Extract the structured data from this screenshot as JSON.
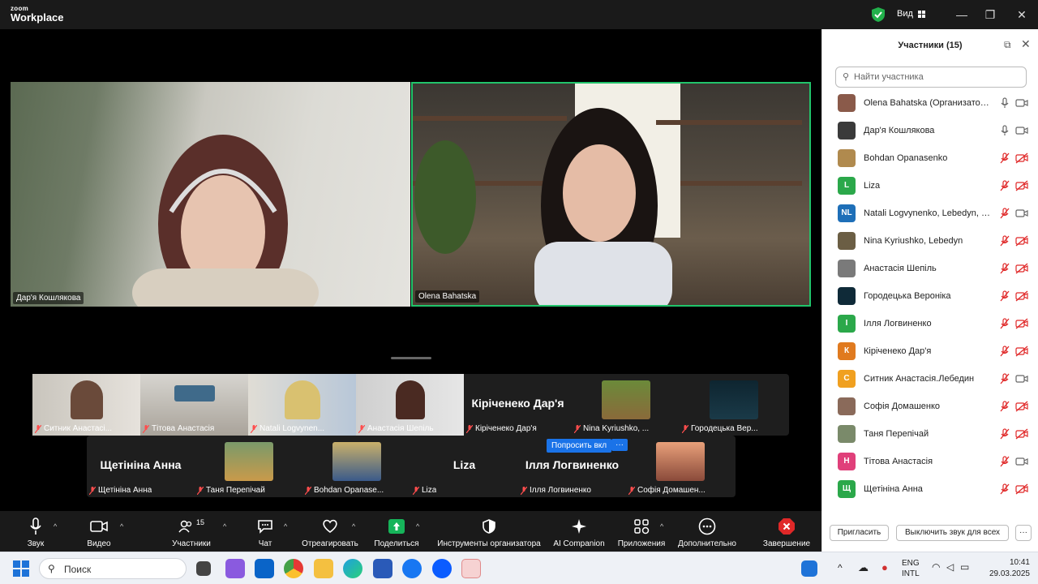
{
  "window": {
    "logo_top": "zoom",
    "logo_bottom": "Workplace",
    "view_label": "Вид",
    "minimize": "—",
    "maximize": "❐",
    "close": "✕"
  },
  "stage": {
    "main_videos": [
      {
        "name": "Дар'я Кошлякова"
      },
      {
        "name": "Olena Bahatska"
      }
    ],
    "gallery_row1": [
      {
        "name": "Ситник Анастасі...",
        "big": ""
      },
      {
        "name": "Тітова Анастасія",
        "big": ""
      },
      {
        "name": "Natali Logvynen...",
        "big": ""
      },
      {
        "name": "Анастасія Шепіль",
        "big": ""
      },
      {
        "name": "Кіріченеко Дар'я",
        "big": "Кіріченеко Дар'я"
      },
      {
        "name": "Nina Kyriushko, ...",
        "big": ""
      },
      {
        "name": "Городецька Вер...",
        "big": ""
      }
    ],
    "gallery_row2": [
      {
        "name": "Щетініна Анна",
        "big": "Щетініна Анна"
      },
      {
        "name": "Таня Перепічай",
        "big": ""
      },
      {
        "name": "Bohdan Opanase...",
        "big": ""
      },
      {
        "name": "Liza",
        "big": "Liza"
      },
      {
        "name": "Ілля Логвиненко",
        "big": "Ілля Логвиненко"
      },
      {
        "name": "Софія Домашен...",
        "big": ""
      }
    ],
    "spotlight_button": "Попросить вкл",
    "more_button": "···"
  },
  "toolbar": {
    "audio": "Звук",
    "video": "Видео",
    "participants": "Участники",
    "participants_count": "15",
    "chat": "Чат",
    "react": "Отреагировать",
    "share": "Поделиться",
    "host_tools": "Инструменты организатора",
    "ai": "AI Companion",
    "apps": "Приложения",
    "more": "Дополнительно",
    "end": "Завершение"
  },
  "panel": {
    "title": "Участники (15)",
    "search_placeholder": "Найти участника",
    "participants": [
      {
        "name": "Olena Bahatska (Организатор, я)",
        "initials": "",
        "color": "#8a5a4a",
        "mic": "on",
        "cam": "on"
      },
      {
        "name": "Дар'я Кошлякова",
        "initials": "",
        "color": "#3a3a3a",
        "mic": "on",
        "cam": "on"
      },
      {
        "name": "Bohdan Opanasenko",
        "initials": "",
        "color": "#b08a4e",
        "mic": "off",
        "cam": "off"
      },
      {
        "name": "Liza",
        "initials": "L",
        "color": "#2ba84a",
        "mic": "off",
        "cam": "off"
      },
      {
        "name": "Natali Logvynenko, Lebedyn, Sum...",
        "initials": "NL",
        "color": "#1e6fb8",
        "mic": "off",
        "cam": "on"
      },
      {
        "name": "Nina Kyriushko, Lebedyn",
        "initials": "",
        "color": "#6b5e44",
        "mic": "off",
        "cam": "off"
      },
      {
        "name": "Анастасія Шепіль",
        "initials": "",
        "color": "#7a7a7a",
        "mic": "off",
        "cam": "off"
      },
      {
        "name": "Городецька Вероніка",
        "initials": "",
        "color": "#0f2a38",
        "mic": "off",
        "cam": "off"
      },
      {
        "name": "Ілля Логвиненко",
        "initials": "І",
        "color": "#2ba84a",
        "mic": "off",
        "cam": "off"
      },
      {
        "name": "Кіріченеко Дар'я",
        "initials": "К",
        "color": "#e07a1f",
        "mic": "off",
        "cam": "off"
      },
      {
        "name": "Ситник Анастасія.Лебедин",
        "initials": "С",
        "color": "#f0a020",
        "mic": "off",
        "cam": "on"
      },
      {
        "name": "Софія Домашенко",
        "initials": "",
        "color": "#8a6a5a",
        "mic": "off",
        "cam": "off"
      },
      {
        "name": "Таня Перепічай",
        "initials": "",
        "color": "#7a8a6a",
        "mic": "off",
        "cam": "off"
      },
      {
        "name": "Тітова Анастасія",
        "initials": "Н",
        "color": "#e0407a",
        "mic": "off",
        "cam": "on"
      },
      {
        "name": "Щетініна Анна",
        "initials": "Щ",
        "color": "#2ba84a",
        "mic": "off",
        "cam": "off"
      }
    ],
    "invite": "Пригласить",
    "mute_all": "Выключить звук для всех",
    "more": "···"
  },
  "taskbar": {
    "search": "Поиск",
    "lang_top": "ENG",
    "lang_bottom": "INTL",
    "time": "10:41",
    "date": "29.03.2025"
  }
}
